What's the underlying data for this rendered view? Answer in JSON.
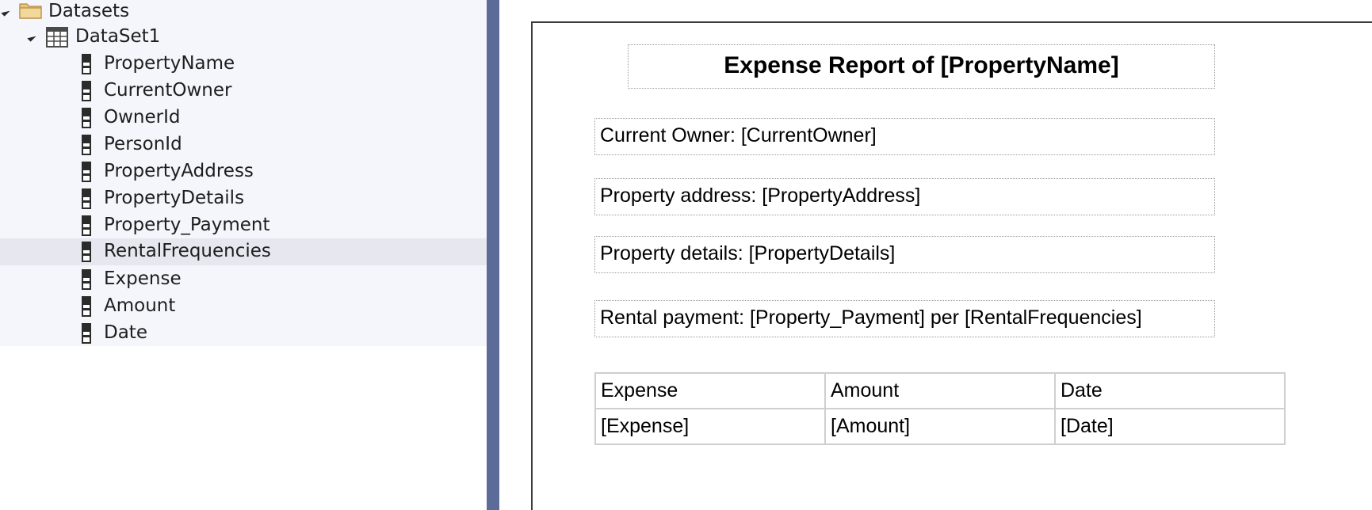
{
  "tree": {
    "root": {
      "label": "Datasets",
      "icon": "folder-icon"
    },
    "dataset": {
      "label": "DataSet1",
      "icon": "table-icon"
    },
    "fields": [
      {
        "label": "PropertyName"
      },
      {
        "label": "CurrentOwner"
      },
      {
        "label": "OwnerId"
      },
      {
        "label": "PersonId"
      },
      {
        "label": "PropertyAddress"
      },
      {
        "label": "PropertyDetails"
      },
      {
        "label": "Property_Payment"
      },
      {
        "label": "RentalFrequencies",
        "selected": true
      },
      {
        "label": "Expense"
      },
      {
        "label": "Amount"
      },
      {
        "label": "Date"
      }
    ]
  },
  "report": {
    "title": "Expense Report of [PropertyName]",
    "owner": "Current Owner: [CurrentOwner]",
    "address": "Property address: [PropertyAddress]",
    "details": "Property details: [PropertyDetails]",
    "rental": "Rental payment: [Property_Payment] per [RentalFrequencies]",
    "table": {
      "headers": [
        "Expense",
        "Amount",
        "Date"
      ],
      "row": [
        "[Expense]",
        "[Amount]",
        "[Date]"
      ]
    }
  },
  "colors": {
    "tree_background": "#f5f6fc",
    "selected_row": "#e6e7ef",
    "splitter": "#5d6b98"
  }
}
